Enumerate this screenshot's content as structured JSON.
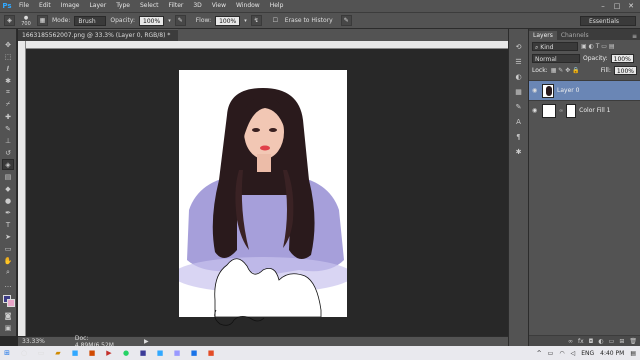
{
  "app": {
    "logo": "Ps"
  },
  "menu": [
    "File",
    "Edit",
    "Image",
    "Layer",
    "Type",
    "Select",
    "Filter",
    "3D",
    "View",
    "Window",
    "Help"
  ],
  "window_controls": {
    "minimize": "–",
    "maximize": "□",
    "close": "✕"
  },
  "options": {
    "brush_size": "700",
    "mode_label": "Mode:",
    "mode_value": "Brush",
    "opacity_label": "Opacity:",
    "opacity_value": "100%",
    "flow_label": "Flow:",
    "flow_value": "100%",
    "erase_history": "Erase to History",
    "workspace": "Essentials"
  },
  "document": {
    "tab_title": "1663185562007.png @ 33.3% (Layer 0, RGB/8) *",
    "zoom": "33.33%",
    "doc_size": "Doc: 4.89M/6.52M"
  },
  "layers_panel": {
    "tabs": [
      "Layers",
      "Channels"
    ],
    "filter": "Kind",
    "blend": "Normal",
    "opacity_label": "Opacity:",
    "opacity_value": "100%",
    "lock_label": "Lock:",
    "fill_label": "Fill:",
    "fill_value": "100%",
    "layers": [
      {
        "name": "Layer 0",
        "selected": true
      },
      {
        "name": "Color Fill 1",
        "selected": false
      }
    ]
  },
  "taskbar": {
    "lang": "ENG",
    "time": "4:40 PM"
  },
  "colors": {
    "foreground": "#3d3d86",
    "background": "#e8a6c8",
    "selection": "#6a86b5"
  }
}
